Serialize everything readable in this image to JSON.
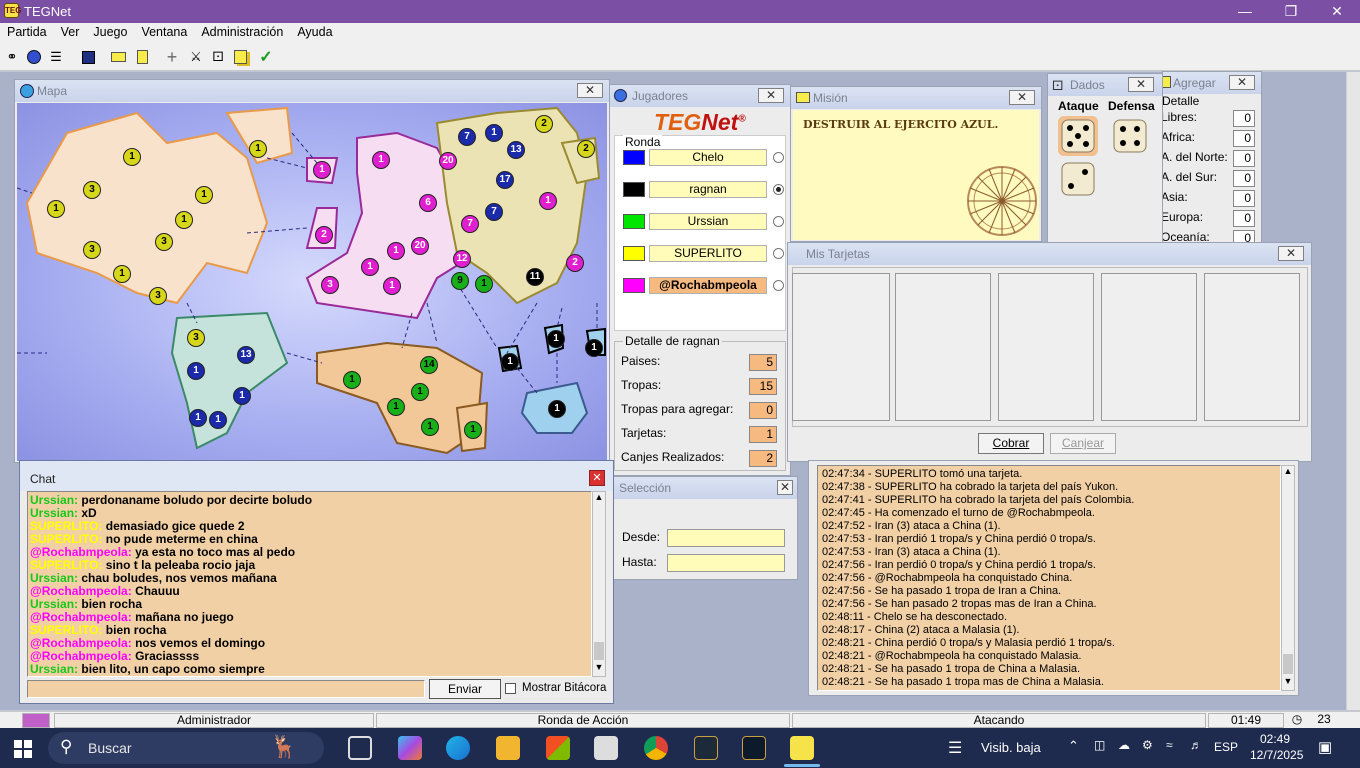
{
  "app": {
    "title": "TEGNet",
    "icon_text": "TEG"
  },
  "menu": [
    "Partida",
    "Ver",
    "Juego",
    "Ventana",
    "Administración",
    "Ayuda"
  ],
  "colors": {
    "titlebar": "#7b4fa3",
    "panel_orange": "#f2d0a6",
    "blue": "#0000ff",
    "black": "#000000",
    "green": "#00e600",
    "yellow": "#ffff00",
    "magenta": "#ff00ff"
  },
  "map": {
    "title": "Mapa"
  },
  "players": {
    "title": "Jugadores",
    "logo_teg": "TEG",
    "logo_net": "Net",
    "logo_reg": "®",
    "round_label": "Ronda",
    "list": [
      {
        "name": "Chelo",
        "color": "#0000ff"
      },
      {
        "name": "ragnan",
        "color": "#000000"
      },
      {
        "name": "Urssian",
        "color": "#00e600"
      },
      {
        "name": "SUPERLITO",
        "color": "#ffff00"
      },
      {
        "name": "@Rochabmpeola",
        "color": "#ff00ff"
      }
    ],
    "detail_title": "Detalle de ragnan",
    "stats": [
      {
        "label": "Paises:",
        "value": "5"
      },
      {
        "label": "Tropas:",
        "value": "15"
      },
      {
        "label": "Tropas para agregar:",
        "value": "0"
      },
      {
        "label": "Tarjetas:",
        "value": "1"
      },
      {
        "label": "Canjes Realizados:",
        "value": "2"
      }
    ]
  },
  "mission": {
    "title": "Misión",
    "text": "DESTRUIR AL EJERCITO AZUL."
  },
  "dice": {
    "title": "Dados",
    "attack_label": "Ataque",
    "defense_label": "Defensa"
  },
  "add": {
    "title": "Agregar",
    "detail_label": "Detalle",
    "rows": [
      {
        "label": "Libres:",
        "value": "0"
      },
      {
        "label": "Africa:",
        "value": "0"
      },
      {
        "label": "A. del Norte:",
        "value": "0"
      },
      {
        "label": "A. del Sur:",
        "value": "0"
      },
      {
        "label": "Asia:",
        "value": "0"
      },
      {
        "label": "Europa:",
        "value": "0"
      },
      {
        "label": "Oceanía:",
        "value": "0"
      }
    ]
  },
  "cards": {
    "title": "Mis Tarjetas",
    "cobrar": "Cobrar",
    "canjear": "Canjear"
  },
  "selection": {
    "title": "Selección",
    "from_label": "Desde:",
    "to_label": "Hasta:"
  },
  "chat": {
    "title": "Chat",
    "send_label": "Enviar",
    "show_log_label": "Mostrar Bitácora",
    "messages": [
      {
        "user": "Urssian:",
        "text": "perdonaname boludo por decirte boludo",
        "color": "#18c818"
      },
      {
        "user": "Urssian:",
        "text": "xD",
        "color": "#18c818"
      },
      {
        "user": "SUPERLITO:",
        "text": "demasiado gice quede 2",
        "color": "#ffff00"
      },
      {
        "user": "SUPERLITO:",
        "text": "no pude meterme en china",
        "color": "#ffff00"
      },
      {
        "user": "@Rochabmpeola:",
        "text": "ya esta no toco mas al pedo",
        "color": "#ff00ff"
      },
      {
        "user": "SUPERLITO:",
        "text": "sino t la peleaba rocio jaja",
        "color": "#ffff00"
      },
      {
        "user": "Urssian:",
        "text": "chau boludes, nos vemos mañana",
        "color": "#18c818"
      },
      {
        "user": "@Rochabmpeola:",
        "text": "Chauuu",
        "color": "#ff00ff"
      },
      {
        "user": "Urssian:",
        "text": "bien rocha",
        "color": "#18c818"
      },
      {
        "user": "@Rochabmpeola:",
        "text": "mañana no juego",
        "color": "#ff00ff"
      },
      {
        "user": "SUPERLITO:",
        "text": "bien rocha",
        "color": "#ffff00"
      },
      {
        "user": "@Rochabmpeola:",
        "text": "nos vemos el domingo",
        "color": "#ff00ff"
      },
      {
        "user": "@Rochabmpeola:",
        "text": "Graciassss",
        "color": "#ff00ff"
      },
      {
        "user": "Urssian:",
        "text": "bien lito, un capo como siempre",
        "color": "#18c818"
      }
    ]
  },
  "log": [
    "02:47:34 - SUPERLITO tomó una tarjeta.",
    "02:47:38 - SUPERLITO ha cobrado la tarjeta del país Yukon.",
    "02:47:41 - SUPERLITO ha cobrado la tarjeta del país Colombia.",
    "02:47:45 - Ha comenzado el turno de @Rochabmpeola.",
    "02:47:52 - Iran (3) ataca a China (1).",
    "02:47:53 - Iran perdió 1 tropa/s y China perdió 0 tropa/s.",
    "02:47:53 - Iran (3) ataca a China (1).",
    "02:47:56 - Iran perdió 0 tropa/s y China perdió 1 tropa/s.",
    "02:47:56 - @Rochabmpeola ha conquistado China.",
    "02:47:56 - Se ha pasado 1 tropa de Iran a China.",
    "02:47:56 - Se han pasado 2 tropas mas de Iran a China.",
    "02:48:11 - Chelo se ha desconectado.",
    "02:48:17 - China (2) ataca a Malasia (1).",
    "02:48:21 - China perdió 0 tropa/s y Malasia perdió 1 tropa/s.",
    "02:48:21 - @Rochabmpeola ha conquistado Malasia.",
    "02:48:21 - Se ha pasado 1 tropa de China a Malasia.",
    "02:48:21 - Se ha pasado 1 tropa mas de China a Malasia."
  ],
  "status": {
    "role": "Administrador",
    "phase": "Ronda de Acción",
    "action": "Atacando",
    "time": "01:49",
    "count": "23"
  },
  "taskbar": {
    "search_placeholder": "Buscar",
    "weather": "Visib. baja",
    "lang": "ESP",
    "time": "02:49",
    "date": "12/7/2025"
  }
}
